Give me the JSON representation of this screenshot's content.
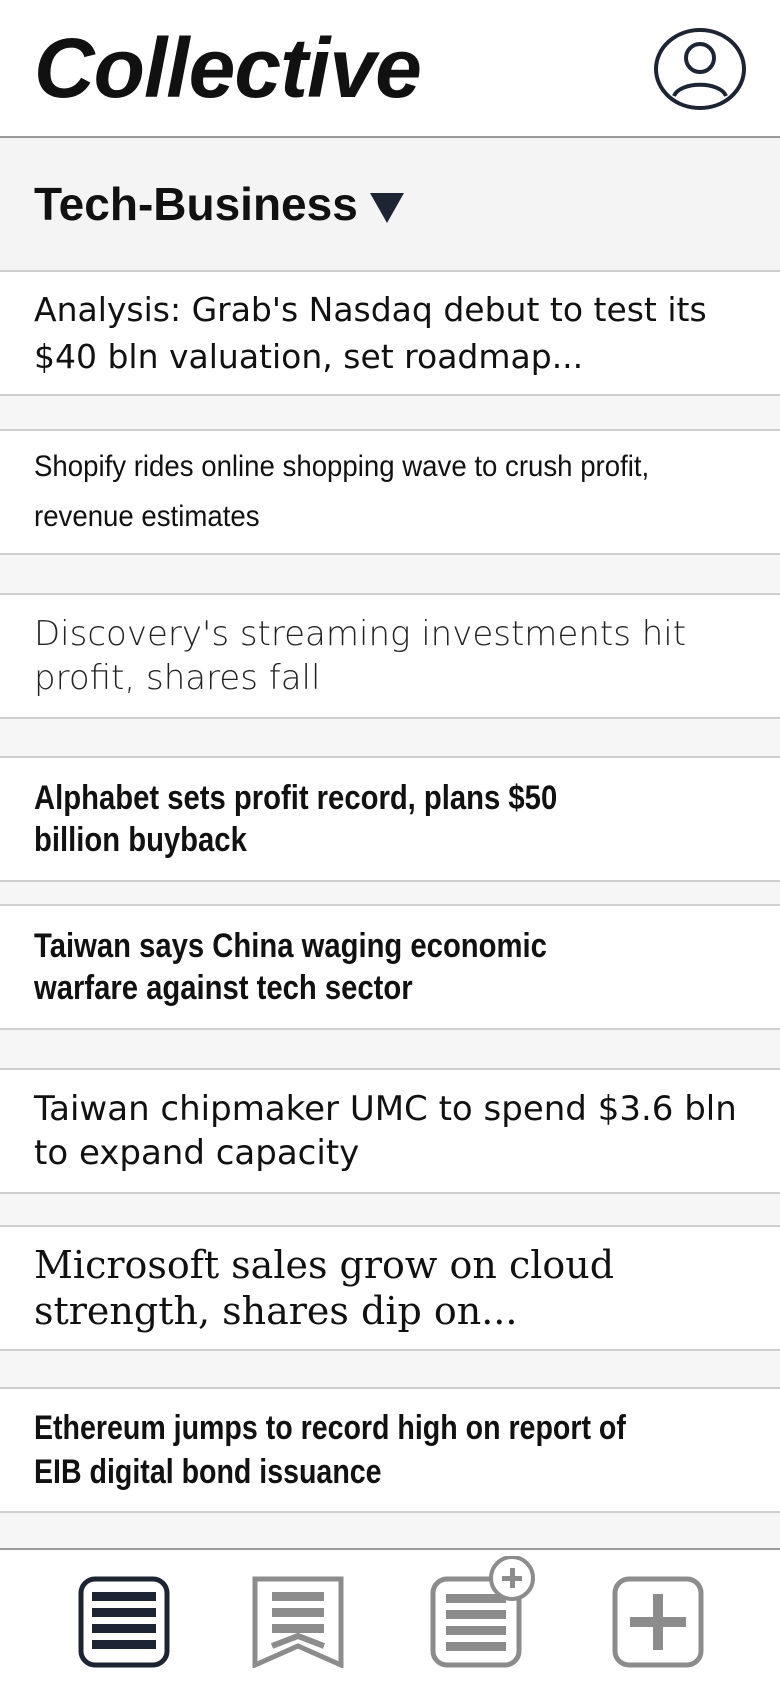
{
  "header": {
    "app_title": "Collective",
    "profile_icon": "person-circle-icon"
  },
  "section": {
    "title": "Tech-Business",
    "dropdown_icon": "triangle-down-icon"
  },
  "articles": [
    {
      "headline": "Analysis: Grab's Nasdaq debut to test its $40 bln valuation, set roadmap..."
    },
    {
      "headline": "Shopify rides online shopping wave to crush profit, revenue estimates"
    },
    {
      "headline": "Discovery's streaming investments hit profit, shares fall"
    },
    {
      "headline": "Alphabet sets profit record, plans $50 billion buyback"
    },
    {
      "headline": "Taiwan says China waging economic warfare against tech sector"
    },
    {
      "headline": "Taiwan chipmaker UMC to spend $3.6 bln to expand capacity"
    },
    {
      "headline": "Microsoft sales grow on cloud strength, shares dip on..."
    },
    {
      "headline": "Ethereum jumps to record high on report of EIB digital bond issuance"
    }
  ],
  "bottom_tabs": [
    {
      "name": "feed",
      "icon": "list-icon",
      "active": true
    },
    {
      "name": "saved",
      "icon": "bookmark-list-icon",
      "active": false
    },
    {
      "name": "add-feed",
      "icon": "list-plus-icon",
      "active": false
    },
    {
      "name": "add",
      "icon": "plus-icon",
      "active": false
    }
  ],
  "colors": {
    "accent": "#1d2433",
    "inactive": "#8c8c8c",
    "background": "#f6f6f6"
  }
}
